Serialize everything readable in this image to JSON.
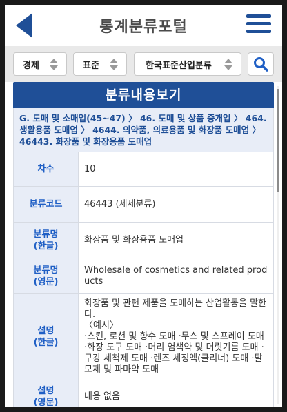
{
  "header": {
    "title": "통계분류포털",
    "back_icon": "back-arrow-icon",
    "menu_icon": "hamburger-menu-icon",
    "brand_color": "#1f4f97"
  },
  "filters": {
    "category": "경제",
    "standard": "표준",
    "classification": "한국표준산업분류",
    "search_icon": "search-icon"
  },
  "section": {
    "title": "분류내용보기"
  },
  "breadcrumb": [
    "G. 도매 및 소매업(45~47)",
    "46. 도매 및 상품 중개업",
    "464. 생활용품 도매업",
    "4644. 의약품, 의료용품 및 화장품 도매업",
    "46443. 화장품 및 화장용품 도매업"
  ],
  "breadcrumb_separator": " 〉 ",
  "details": {
    "degree_label": "차수",
    "degree_value": "10",
    "code_label": "분류코드",
    "code_value": "46443 (세세분류)",
    "name_ko_label": "분류명\n(한글)",
    "name_ko_value": "화장품 및 화장용품 도매업",
    "name_en_label": "분류명\n(영문)",
    "name_en_value": "Wholesale of cosmetics and related products",
    "desc_ko_label": "설명\n(한글)",
    "desc_ko_value": "화장품 및 관련 제품을 도매하는 산업활동을 말한다.\n〈예시〉\n·스킨, 로션 및 향수 도매 ·무스 및 스프레이 도매 ·화장 도구 도매 ·머리 염색약 및 머릿기름 도매 ·구강 세척제 도매 ·렌즈 세정액(클리너) 도매 ·탈모제 및 파마약 도매",
    "desc_en_label": "설명\n(영문)",
    "desc_en_value": "내용 없음"
  }
}
